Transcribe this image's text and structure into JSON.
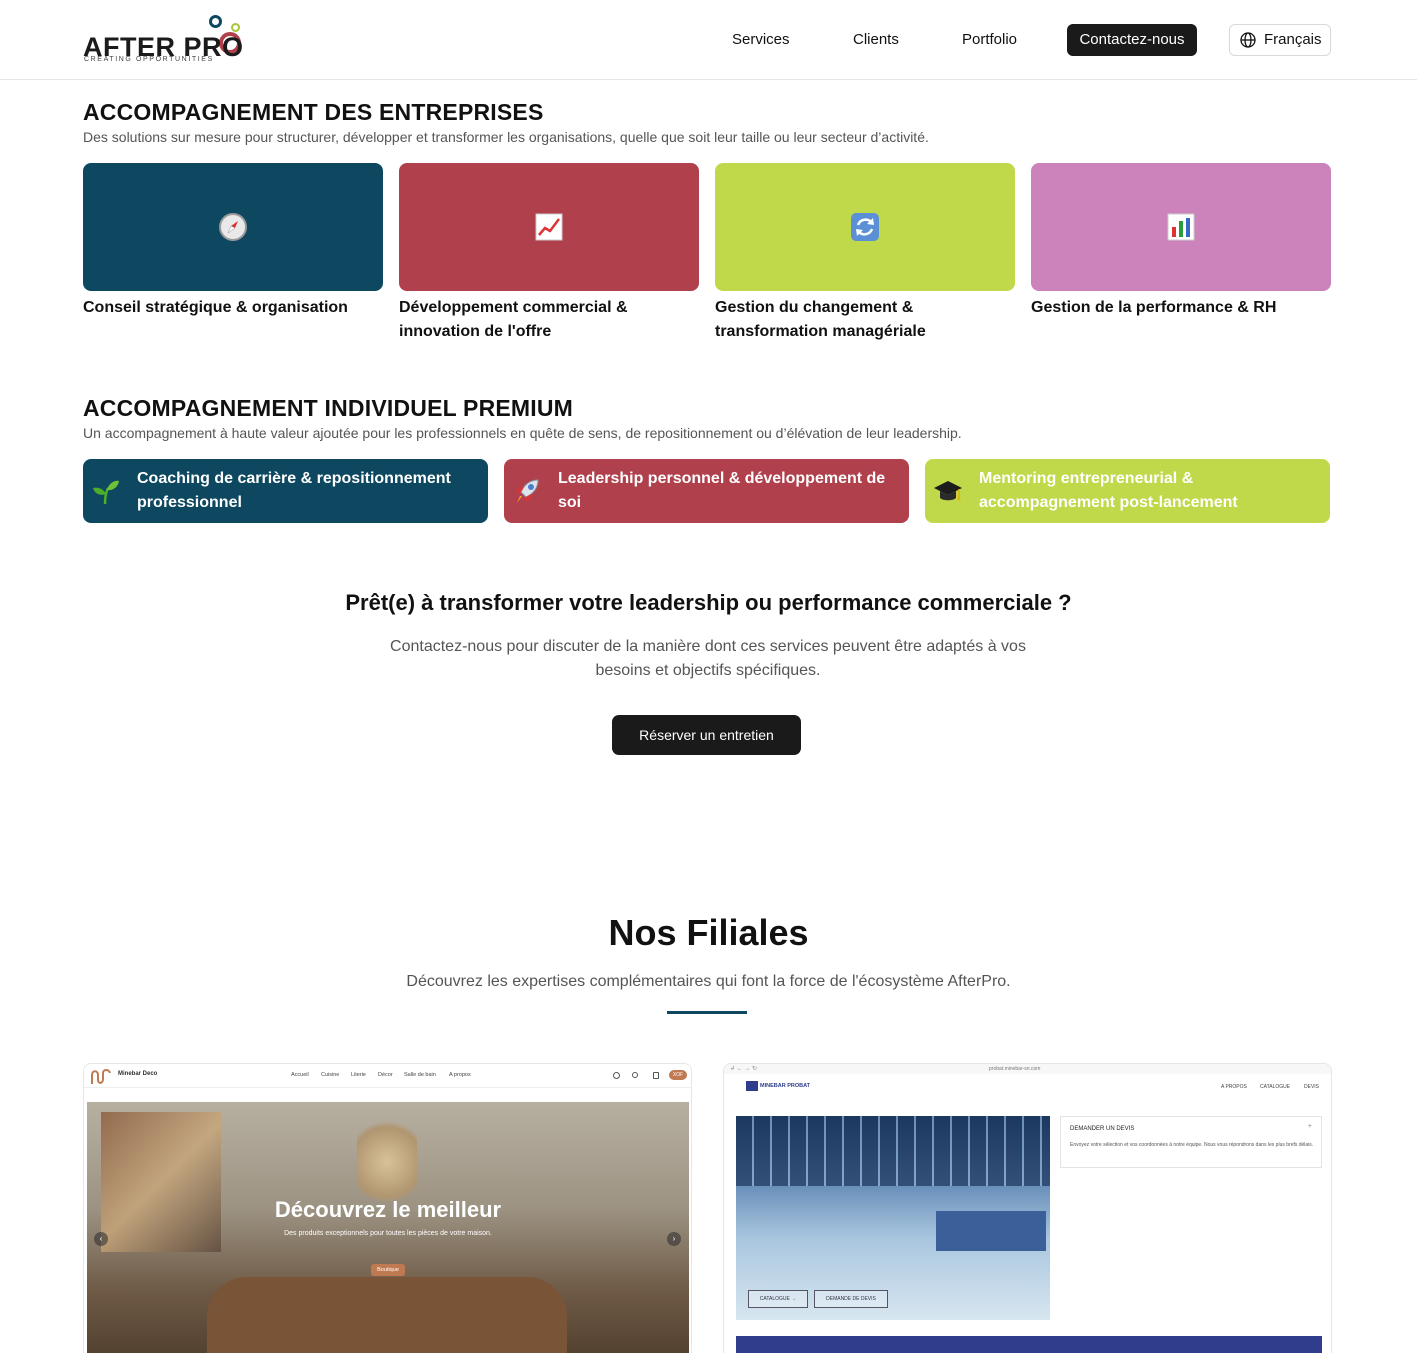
{
  "header": {
    "logo_text": "AFTER PRO",
    "logo_tagline": "CREATING OPPORTUNITIES",
    "nav": [
      "Services",
      "Clients",
      "Portfolio"
    ],
    "contact_label": "Contactez-nous",
    "language_label": "Français"
  },
  "enterprise": {
    "title": "ACCOMPAGNEMENT DES ENTREPRISES",
    "subtitle": "Des solutions sur mesure pour structurer, développer et transformer les organisations, quelle que soit leur taille ou leur secteur d’activité.",
    "cards": [
      {
        "label": "Conseil stratégique & organisation",
        "icon": "compass-icon",
        "color": "#0d4860"
      },
      {
        "label": "Développement commercial & innovation de l'offre",
        "icon": "chart-up-icon",
        "color": "#b0404c"
      },
      {
        "label": "Gestion du changement & transformation managériale",
        "icon": "refresh-icon",
        "color": "#c0d94a"
      },
      {
        "label": "Gestion de la performance & RH",
        "icon": "bar-chart-icon",
        "color": "#cc83bc"
      }
    ]
  },
  "premium": {
    "title": "ACCOMPAGNEMENT INDIVIDUEL PREMIUM",
    "subtitle": "Un accompagnement à haute valeur ajoutée pour les professionnels en quête de sens, de repositionnement ou d’élévation de leur leadership.",
    "items": [
      {
        "label": "Coaching de carrière & repositionnement professionnel",
        "icon": "seedling-icon",
        "color": "#0d4860"
      },
      {
        "label": "Leadership personnel & développement de soi",
        "icon": "rocket-icon",
        "color": "#b0404c"
      },
      {
        "label": "Mentoring entrepreneurial & accompagnement post-lancement",
        "icon": "graduation-cap-icon",
        "color": "#c0d94a"
      }
    ]
  },
  "cta": {
    "title": "Prêt(e) à transformer votre leadership ou performance commerciale ?",
    "text": "Contactez-nous pour discuter de la manière dont ces services peuvent être adaptés à vos besoins et objectifs spécifiques.",
    "button": "Réserver un entretien"
  },
  "filiales": {
    "title": "Nos Filiales",
    "subtitle": "Découvrez les expertises complémentaires qui font la force de l'écosystème AfterPro.",
    "deco": {
      "brand": "Minebar Deco",
      "nav": [
        "Accueil",
        "Cuisine",
        "Literie",
        "Décor",
        "Salle de bain",
        "A propos"
      ],
      "badge": "XOF",
      "hero_title": "Découvrez le meilleur",
      "hero_sub": "Des produits exceptionnels pour toutes les pièces de votre maison.",
      "hero_button": "Boutique"
    },
    "probat": {
      "url": "probat.minebar-sn.com",
      "brand": "MINEBAR PROBAT",
      "nav": [
        "A PROPOS",
        "CATALOGUE",
        "DEVIS"
      ],
      "quote_title": "DEMANDER UN DEVIS",
      "quote_text": "Envoyez votre sélection et vos coordonnées à notre équipe. Nous vous répondrons dans les plus brefs délais.",
      "btn_catalogue": "CATALOGUE →",
      "btn_devis": "DEMANDE DE DEVIS"
    }
  }
}
